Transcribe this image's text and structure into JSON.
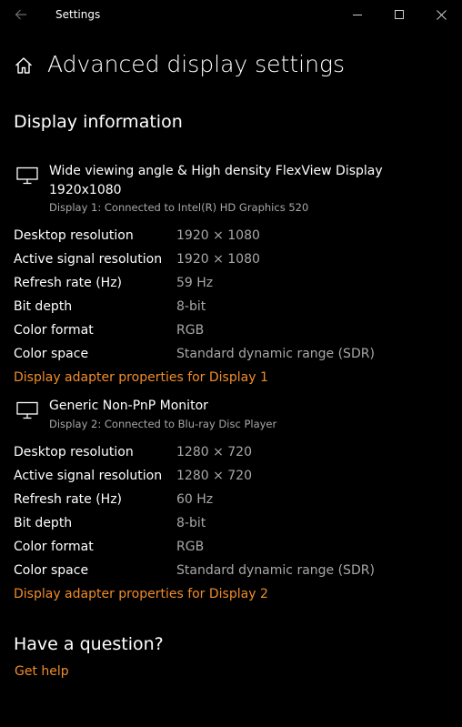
{
  "window": {
    "title": "Settings",
    "back_icon": "back-arrow-icon",
    "minimize_icon": "minimize-icon",
    "maximize_icon": "maximize-icon",
    "close_icon": "close-icon"
  },
  "page": {
    "home_icon": "home-icon",
    "title": "Advanced display settings"
  },
  "display_information": {
    "heading": "Display information",
    "displays": [
      {
        "icon": "monitor-icon",
        "name": "Wide viewing angle & High density FlexView Display",
        "resolution_line": "1920x1080",
        "subtitle": "Display 1: Connected to Intel(R) HD Graphics 520",
        "rows": [
          {
            "label": "Desktop resolution",
            "value": "1920 × 1080"
          },
          {
            "label": "Active signal resolution",
            "value": "1920 × 1080"
          },
          {
            "label": "Refresh rate (Hz)",
            "value": "59 Hz"
          },
          {
            "label": "Bit depth",
            "value": "8-bit"
          },
          {
            "label": "Color format",
            "value": "RGB"
          },
          {
            "label": "Color space",
            "value": "Standard dynamic range (SDR)"
          }
        ],
        "link": "Display adapter properties for Display 1"
      },
      {
        "icon": "monitor-icon",
        "name": "Generic Non-PnP Monitor",
        "subtitle": "Display 2: Connected to Blu-ray Disc Player",
        "rows": [
          {
            "label": "Desktop resolution",
            "value": "1280 × 720"
          },
          {
            "label": "Active signal resolution",
            "value": "1280 × 720"
          },
          {
            "label": "Refresh rate (Hz)",
            "value": "60 Hz"
          },
          {
            "label": "Bit depth",
            "value": "8-bit"
          },
          {
            "label": "Color format",
            "value": "RGB"
          },
          {
            "label": "Color space",
            "value": "Standard dynamic range (SDR)"
          }
        ],
        "link": "Display adapter properties for Display 2"
      }
    ]
  },
  "help": {
    "heading": "Have a question?",
    "link": "Get help"
  },
  "colors": {
    "background": "#000000",
    "text": "#ffffff",
    "secondary_text": "#a8a8a8",
    "accent_link": "#f08c2a"
  }
}
